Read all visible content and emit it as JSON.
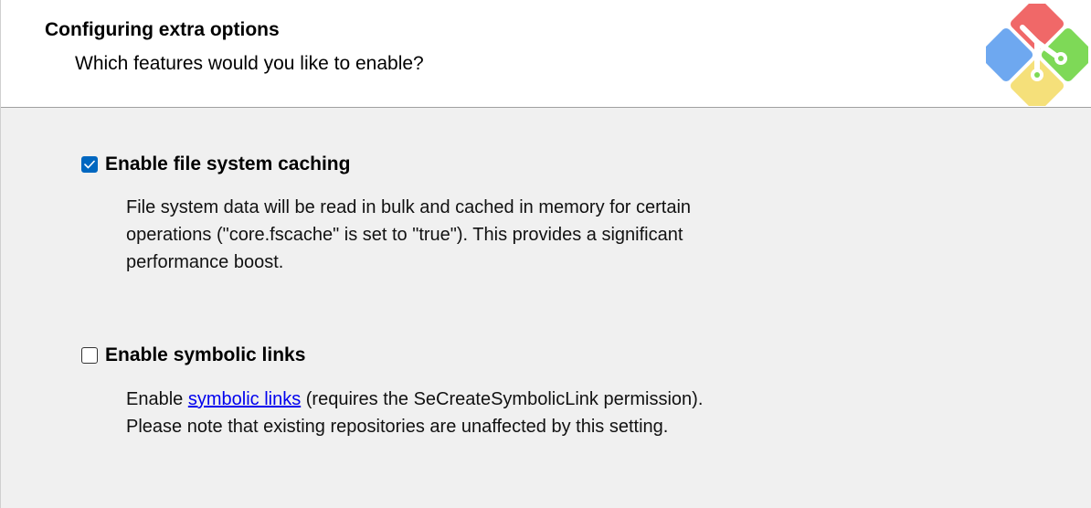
{
  "header": {
    "title": "Configuring extra options",
    "subtitle": "Which features would you like to enable?",
    "logo_icon": "git-logo-icon"
  },
  "options": [
    {
      "label": "Enable file system caching",
      "checked": true,
      "description_lines": [
        "File system data will be read in bulk and cached in memory for certain",
        "operations (\"core.fscache\" is set to \"true\"). This provides a significant",
        "performance boost."
      ]
    },
    {
      "label": "Enable symbolic links",
      "checked": false,
      "description_prefix": "Enable ",
      "description_link": "symbolic links",
      "description_suffix": " (requires the SeCreateSymbolicLink permission).",
      "description_line2": "Please note that existing repositories are unaffected by this setting."
    }
  ],
  "colors": {
    "checkbox_checked": "#0067c0",
    "link": "#0000ee",
    "logo_red": "#f06868",
    "logo_blue": "#6ea8f0",
    "logo_green": "#7ed957",
    "logo_yellow": "#f5e07a"
  }
}
